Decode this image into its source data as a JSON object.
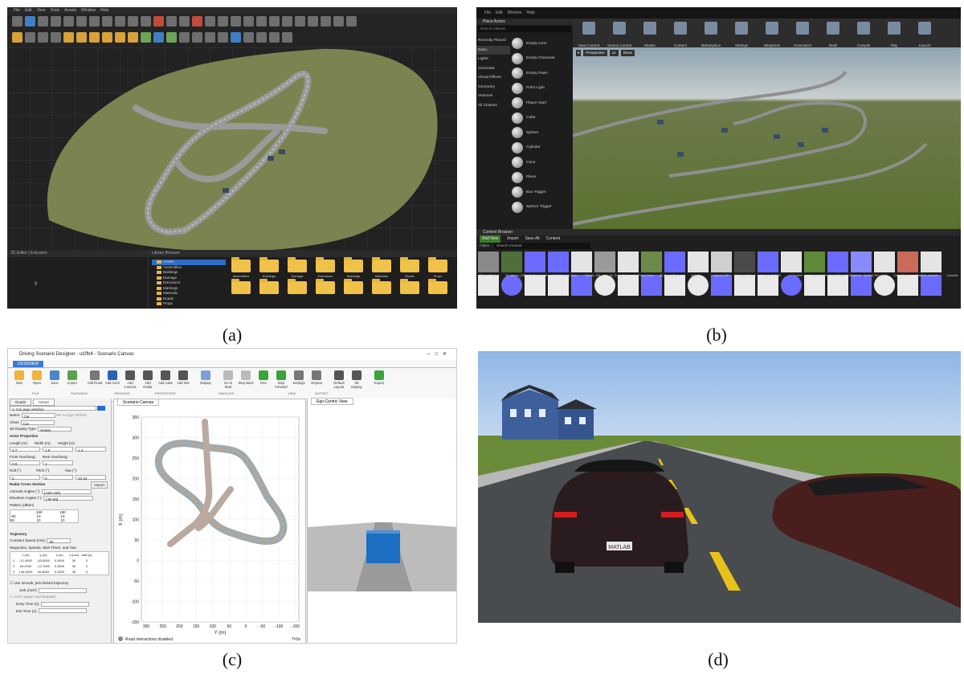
{
  "captions": {
    "a": "(a)",
    "b": "(b)",
    "c": "(c)",
    "d": "(d)"
  },
  "roadrunner": {
    "menu": [
      "File",
      "Edit",
      "View",
      "Tools",
      "Assets",
      "Window",
      "Help"
    ],
    "panel_left_title": "3D Editor | Extrusion",
    "panel_left_value": "0",
    "library_title": "Library Browser",
    "tree": [
      "Assets",
      "Assemblies",
      "Buildings",
      "Damage",
      "Extrusions",
      "Markings",
      "Materials",
      "Roads",
      "Props"
    ],
    "folders": [
      "Assemblies",
      "Buildings",
      "Damage",
      "Extrusions",
      "Markings",
      "Materials",
      "Roads",
      "Props",
      "",
      "",
      "",
      "",
      "",
      "",
      "",
      ""
    ]
  },
  "unreal": {
    "menu": [
      "File",
      "Edit",
      "Window",
      "Help"
    ],
    "place_actors": "Place Actors",
    "search_classes": "Search Classes",
    "categories": [
      "Recently Placed",
      "Basic",
      "Lights",
      "Cinematic",
      "Visual Effects",
      "Geometry",
      "Volumes",
      "All Classes"
    ],
    "items": [
      "Empty Actor",
      "Empty Character",
      "Empty Pawn",
      "Point Light",
      "Player Start",
      "Cube",
      "Sphere",
      "Cylinder",
      "Cone",
      "Plane",
      "Box Trigger",
      "Sphere Trigger"
    ],
    "toolbar": [
      "Save Current",
      "Source Control",
      "Modes",
      "Content",
      "Marketplace",
      "Settings",
      "Blueprints",
      "Cinematics",
      "Build",
      "Compile",
      "Play",
      "Launch"
    ],
    "viewport_buttons": [
      "Perspective",
      "Lit",
      "Show"
    ],
    "content_browser": "Content Browser",
    "cb_buttons": [
      "Add New",
      "Import",
      "Save All",
      "Content"
    ],
    "filters": "Filters",
    "search_content": "Search Content",
    "asset_labels": [
      "Starter Content",
      "3d_Leaves_Diff",
      "3d_Leaves_Norm",
      "3d_Leaves_Spec",
      "3dtrunk_Diff",
      "3d_Trunk_Diff",
      "3d_Trunk_Norm",
      "3d_Trunk_Spec",
      "asphalt",
      "Asphalt_Diff",
      "Asphalt_Norm",
      "Asphalt_Spec",
      "Leaves",
      "Asphalt_Heightmap",
      "Aspahlt_Heightmap2",
      "Asphalt_Roughness",
      "Color_Block",
      "Cracked_Asphalt",
      "Concrete"
    ]
  },
  "dsd": {
    "title": "Driving Scenario Designer - ut2fb4 - Scenario Canvas",
    "designer_tab": "DESIGNER",
    "ribbon": [
      {
        "label": "New"
      },
      {
        "label": "Open"
      },
      {
        "label": "Save"
      },
      {
        "label": "Import"
      },
      {
        "label": "Add Road"
      },
      {
        "label": "Add Actor"
      },
      {
        "label": "Add Camera"
      },
      {
        "label": "Add Radar"
      },
      {
        "label": "Add Lidar"
      },
      {
        "label": "Add INS"
      },
      {
        "label": "Display"
      },
      {
        "label": "Go to Start"
      },
      {
        "label": "Step Back"
      },
      {
        "label": "Run"
      },
      {
        "label": "Step Forward"
      },
      {
        "label": "Settings"
      },
      {
        "label": "Repeat"
      },
      {
        "label": "Default Layout"
      },
      {
        "label": "3D Display"
      },
      {
        "label": "Export"
      }
    ],
    "sections": [
      "FILE",
      "SCENARIO",
      "SENSORS",
      "PROPERTIES",
      "SIMULATE",
      "VIEW",
      "EXPORT"
    ],
    "left_tabs": [
      "Roads",
      "Actors"
    ],
    "actor_select": "1: Car (ego vehicle)",
    "name_label": "Name:",
    "name_value": "Car",
    "set_ego": "Set As Ego Vehicle",
    "class_label": "Class:",
    "class_value": "Car",
    "display_type_label": "3D Display Type:",
    "display_type_value": "Sedan",
    "actor_props": "Actor Properties",
    "length_label": "Length (m):",
    "width_label": "Width (m):",
    "height_label": "Height (m):",
    "length": "4.7",
    "width": "1.8",
    "height": "1.4",
    "front_overhang": "Front Overhang:",
    "rear_overhang": "Rear Overhang:",
    "fo": "0.9",
    "ro": "1",
    "roll_label": "Roll (°):",
    "pitch_label": "Pitch (°):",
    "yaw_label": "Yaw (°):",
    "roll": "0",
    "pitch": "0",
    "yaw": "32.43",
    "radar_section": "Radar Cross Section",
    "import_btn": "Import",
    "azimuth_label": "Azimuth Angles (°):",
    "azimuth": "[-180 180]",
    "elevation_label": "Elevation Angles (°):",
    "elevation": "[-90 90]",
    "pattern_label": "Pattern (dBsm)",
    "pattern_header": [
      "",
      "-180",
      "180"
    ],
    "pattern_rows": [
      [
        "-90",
        "10",
        "10"
      ],
      [
        "90",
        "10",
        "10"
      ]
    ],
    "trajectory": "Trajectory",
    "speed_label": "Constant Speed (m/s):",
    "speed": "30",
    "waypoints_label": "Waypoints, Speeds, Wait Times, and Yaw",
    "wp_header": [
      "",
      "x (m)",
      "y (m)",
      "z (m)",
      "v (m/s)",
      "wait (s)"
    ],
    "wp_rows": [
      [
        "1",
        "-12.4000",
        "-63.6000",
        "0.3000",
        "30",
        "0"
      ],
      [
        "2",
        "60.2000",
        "-14.7000",
        "0.3000",
        "30",
        "0"
      ],
      [
        "3",
        "146.9000",
        "40.8000",
        "0.3000",
        "30",
        "0"
      ]
    ],
    "smooth_label": "Use smooth, jerk-limited trajectory",
    "jerk_label": "Jerk (m/s³):",
    "spawn_label": "Actor spawn and despawn",
    "entry_label": "Entry Time (s):",
    "exit_label": "Exit Time (s):",
    "canvas_tab": "Scenario Canvas",
    "ego_tab": "Ego-Centric View",
    "y_ticks": [
      "350",
      "300",
      "250",
      "200",
      "150",
      "100",
      "50",
      "0",
      "-50",
      "-100",
      "-150"
    ],
    "x_ticks": [
      "300",
      "250",
      "200",
      "150",
      "100",
      "50",
      "0",
      "-50",
      "-100",
      "-150"
    ],
    "x_axis_label": "Y (m)",
    "y_axis_label": "X (m)",
    "road_interactions": "Road interactions disabled",
    "time_label": "T=0s"
  },
  "scene": {
    "plate": "MATLAB"
  }
}
